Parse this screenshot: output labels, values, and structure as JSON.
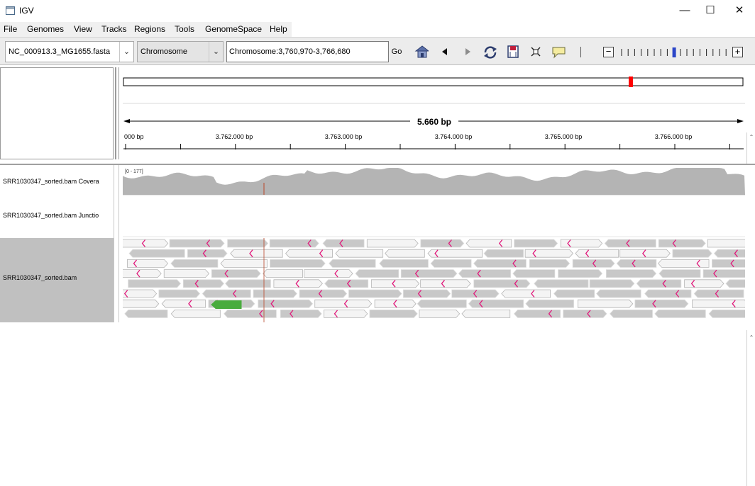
{
  "window": {
    "title": "IGV",
    "minimize": "—",
    "maximize": "☐",
    "close": "✕"
  },
  "menu": [
    "File",
    "Genomes",
    "View",
    "Tracks",
    "Regions",
    "Tools",
    "GenomeSpace",
    "Help"
  ],
  "toolbar": {
    "genome": "NC_000913.3_MG1655.fasta",
    "chromosome": "Chromosome",
    "locus": "Chromosome:3,760,970-3,766,680",
    "go_label": "Go",
    "icons": [
      "home-icon",
      "back-icon",
      "forward-icon",
      "refresh-icon",
      "roi-icon",
      "resize-icon",
      "popup-icon"
    ],
    "zoom_minus": "−",
    "zoom_plus": "+",
    "zoom_level": 8,
    "zoom_ticks": 17
  },
  "ruler": {
    "span_label": "5.660 bp",
    "tick_labels": [
      "000 bp",
      "3.762.000 bp",
      "3.763.000 bp",
      "3.764.000 bp",
      "3.765.000 bp",
      "3.766.000 bp"
    ],
    "range_start": 3760970,
    "range_end": 3766680
  },
  "tracks": {
    "coverage": {
      "name": "SRR1030347_sorted.bam Covera",
      "range_label": "[0 - 177]"
    },
    "junctions": {
      "name": "SRR1030347_sorted.bam Junctio"
    },
    "alignments": {
      "name": "SRR1030347_sorted.bam"
    }
  },
  "colors": {
    "coverage": "#b4b4b4",
    "read": "#c8c8c8",
    "read_outline": "#dcdcdc",
    "insertion": "#e0187a",
    "selected_read": "#49ac3e",
    "ideogram_marker": "#ff0000"
  }
}
